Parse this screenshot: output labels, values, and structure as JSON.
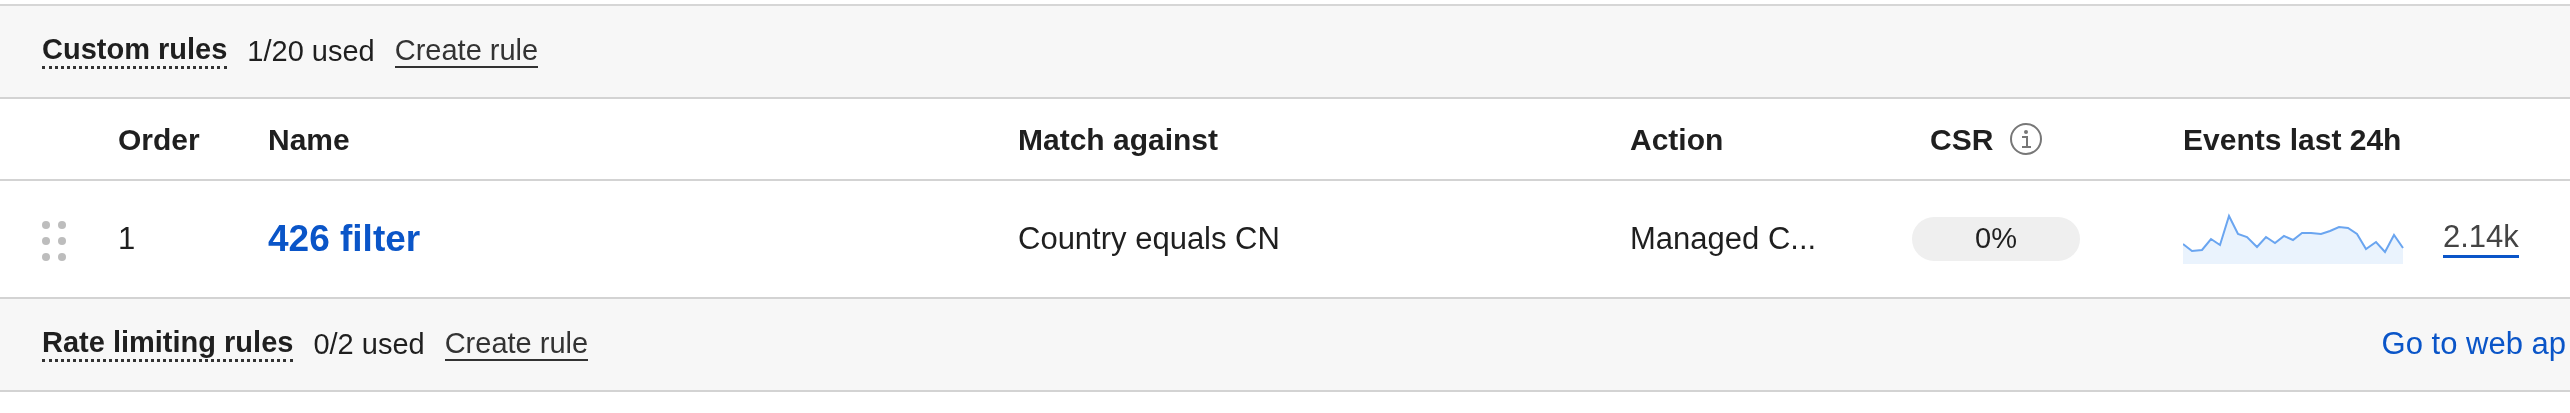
{
  "sections": [
    {
      "title": "Custom rules",
      "usage": "1/20 used",
      "action": "Create rule"
    }
  ],
  "table": {
    "columns": [
      {
        "label": "Order"
      },
      {
        "label": "Name"
      },
      {
        "label": "Match against"
      },
      {
        "label": "Action"
      },
      {
        "label": "CSR",
        "info": true
      },
      {
        "label": "Events last 24h"
      }
    ],
    "rows": [
      {
        "order": "1",
        "name": "426 filter",
        "match": "Country equals CN",
        "action": "Managed C...",
        "csr": "0%",
        "events": "2.14k"
      }
    ]
  },
  "footer_section": {
    "title": "Rate limiting rules",
    "usage": "0/2 used",
    "action": "Create rule",
    "link": "Go to web ap"
  }
}
